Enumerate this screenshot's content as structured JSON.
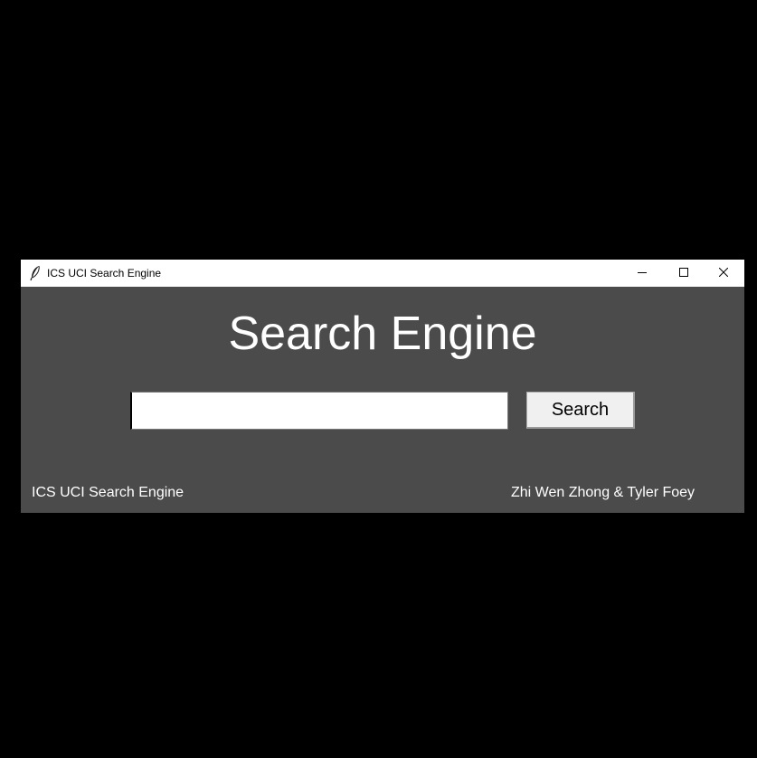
{
  "window": {
    "title": "ICS UCI Search Engine",
    "icon": "feather-icon",
    "controls": {
      "minimize_icon": "minimize-icon",
      "maximize_icon": "maximize-icon",
      "close_icon": "close-icon"
    }
  },
  "main": {
    "heading": "Search Engine",
    "search": {
      "value": "",
      "placeholder": ""
    },
    "search_button_label": "Search"
  },
  "footer": {
    "left_text": "ICS UCI Search Engine",
    "right_text": "Zhi Wen Zhong & Tyler Foey"
  },
  "colors": {
    "desktop_background": "#000000",
    "window_background": "#4b4b4b",
    "titlebar_background": "#ffffff",
    "text_on_dark": "#ffffff",
    "button_background": "#f0f0f0"
  }
}
